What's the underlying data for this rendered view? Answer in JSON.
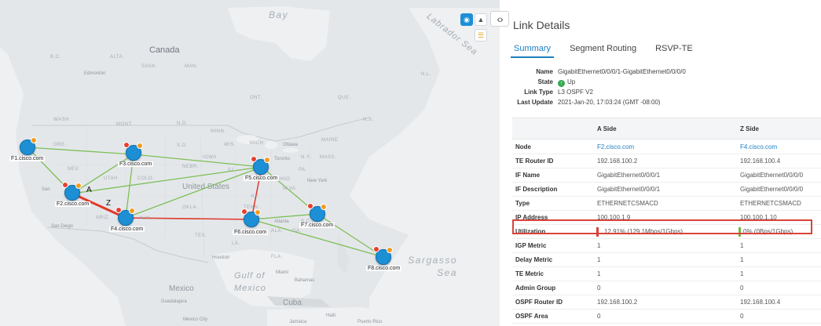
{
  "map": {
    "labels": {
      "bay": "Bay",
      "labrador_sea": "Labrador Sea",
      "canada": "Canada",
      "bc": "B.C.",
      "alta": "ALTA.",
      "sask": "SASK.",
      "man": "MAN.",
      "edmonton": "Edmonton",
      "ont": "ONT.",
      "que": "QUE.",
      "nl": "N.L.",
      "wash": "WASH.",
      "ore": "ORE.",
      "mont": "MONT.",
      "nd": "N.D.",
      "sd": "S.D.",
      "minn": "MINN.",
      "wis": "WIS.",
      "mich": "MICH.",
      "ottawa": "Ottawa",
      "toronto": "Toronto",
      "ny": "N.Y.",
      "mass": "MASS.",
      "maine": "MAINE",
      "ns": "N.S.",
      "nev": "NEV.",
      "utah": "UTAH",
      "colo": "COLO.",
      "nebr": "NEBR.",
      "iowa": "IOWA",
      "ill": "ILL.",
      "ohio": "OHIO",
      "pa": "PA.",
      "wva": "W.VA.",
      "ky": "KY.",
      "tenn": "TENN.",
      "okla": "OKLA.",
      "ariz": "ARIZ.",
      "nm": "N.M.",
      "tex": "TEX.",
      "la": "LA.",
      "ala": "ALA.",
      "ga": "GA.",
      "sc": "S.C.",
      "fla": "FLA.",
      "new_york": "New York",
      "atlanta": "Atlanta",
      "san_diego": "San Diego",
      "houston": "Houston",
      "miami": "Miami",
      "united_states": "United States",
      "gulf_of_mexico": "Gulf of Mexico",
      "mexico": "Mexico",
      "guadalajara": "Guadalajara",
      "mexico_city": "Mexico City",
      "cuba": "Cuba",
      "bahamas": "Bahamas",
      "haiti": "Haiti",
      "jamaica": "Jamaica",
      "puerto_rico": "Puerto Rico",
      "sargasso_sea": "Sargasso Sea",
      "san": "San"
    },
    "nodes": [
      {
        "id": "F1",
        "label": "F1.cisco.com"
      },
      {
        "id": "F2",
        "label": "F2.cisco.com"
      },
      {
        "id": "F3",
        "label": "F3.cisco.com"
      },
      {
        "id": "F4",
        "label": "F4.cisco.com"
      },
      {
        "id": "F5",
        "label": "F5.cisco.com"
      },
      {
        "id": "F6",
        "label": "F6.cisco.com"
      },
      {
        "id": "F7",
        "label": "F7.cisco.com"
      },
      {
        "id": "F8",
        "label": "F8.cisco.com"
      }
    ],
    "link_endpoints": {
      "a": "A",
      "z": "Z"
    },
    "toolbar_icons": [
      "globe-icon",
      "topology-icon",
      "layers-icon"
    ],
    "colors": {
      "node": "#1d8fd4",
      "link": "#7cbf56",
      "selected_link": "#e0392b",
      "badge_red": "#e8402e",
      "badge_orange": "#f39c1f"
    }
  },
  "panel": {
    "title": "Link Details",
    "tabs": [
      "Summary",
      "Segment Routing",
      "RSVP-TE"
    ],
    "active_tab": "Summary",
    "summary": {
      "name_label": "Name",
      "name_value": "GigabitEthernet0/0/0/1-GigabitEthernet0/0/0/0",
      "state_label": "State",
      "state_value": "Up",
      "link_type_label": "Link Type",
      "link_type_value": "L3 OSPF V2",
      "last_update_label": "Last Update",
      "last_update_value": "2021-Jan-20, 17:03:24 (GMT -08:00)"
    },
    "table": {
      "headers": [
        "",
        "A Side",
        "Z Side"
      ],
      "rows": [
        {
          "label": "Node",
          "a": "F2.cisco.com",
          "z": "F4.cisco.com"
        },
        {
          "label": "TE Router ID",
          "a": "192.168.100.2",
          "z": "192.168.100.4"
        },
        {
          "label": "IF Name",
          "a": "GigabitEthernet0/0/0/1",
          "z": "GigabitEthernet0/0/0/0"
        },
        {
          "label": "IF Description",
          "a": "GigabitEthernet0/0/0/1",
          "z": "GigabitEthernet0/0/0/0"
        },
        {
          "label": "Type",
          "a": "ETHERNETCSMACD",
          "z": "ETHERNETCSMACD"
        },
        {
          "label": "IP Address",
          "a": "100.100.1.9",
          "z": "100.100.1.10"
        },
        {
          "label": "Utilization",
          "a": "12.91% (129.1Mbps/1Gbps)",
          "z": "0% (0Bps/1Gbps)"
        },
        {
          "label": "IGP Metric",
          "a": "1",
          "z": "1"
        },
        {
          "label": "Delay Metric",
          "a": "1",
          "z": "1"
        },
        {
          "label": "TE Metric",
          "a": "1",
          "z": "1"
        },
        {
          "label": "Admin Group",
          "a": "0",
          "z": "0"
        },
        {
          "label": "OSPF Router ID",
          "a": "192.168.100.2",
          "z": "192.168.100.4"
        },
        {
          "label": "OSPF Area",
          "a": "0",
          "z": "0"
        }
      ],
      "utilization_colors": {
        "a": "#d9423b",
        "z": "#6fb844"
      }
    }
  }
}
